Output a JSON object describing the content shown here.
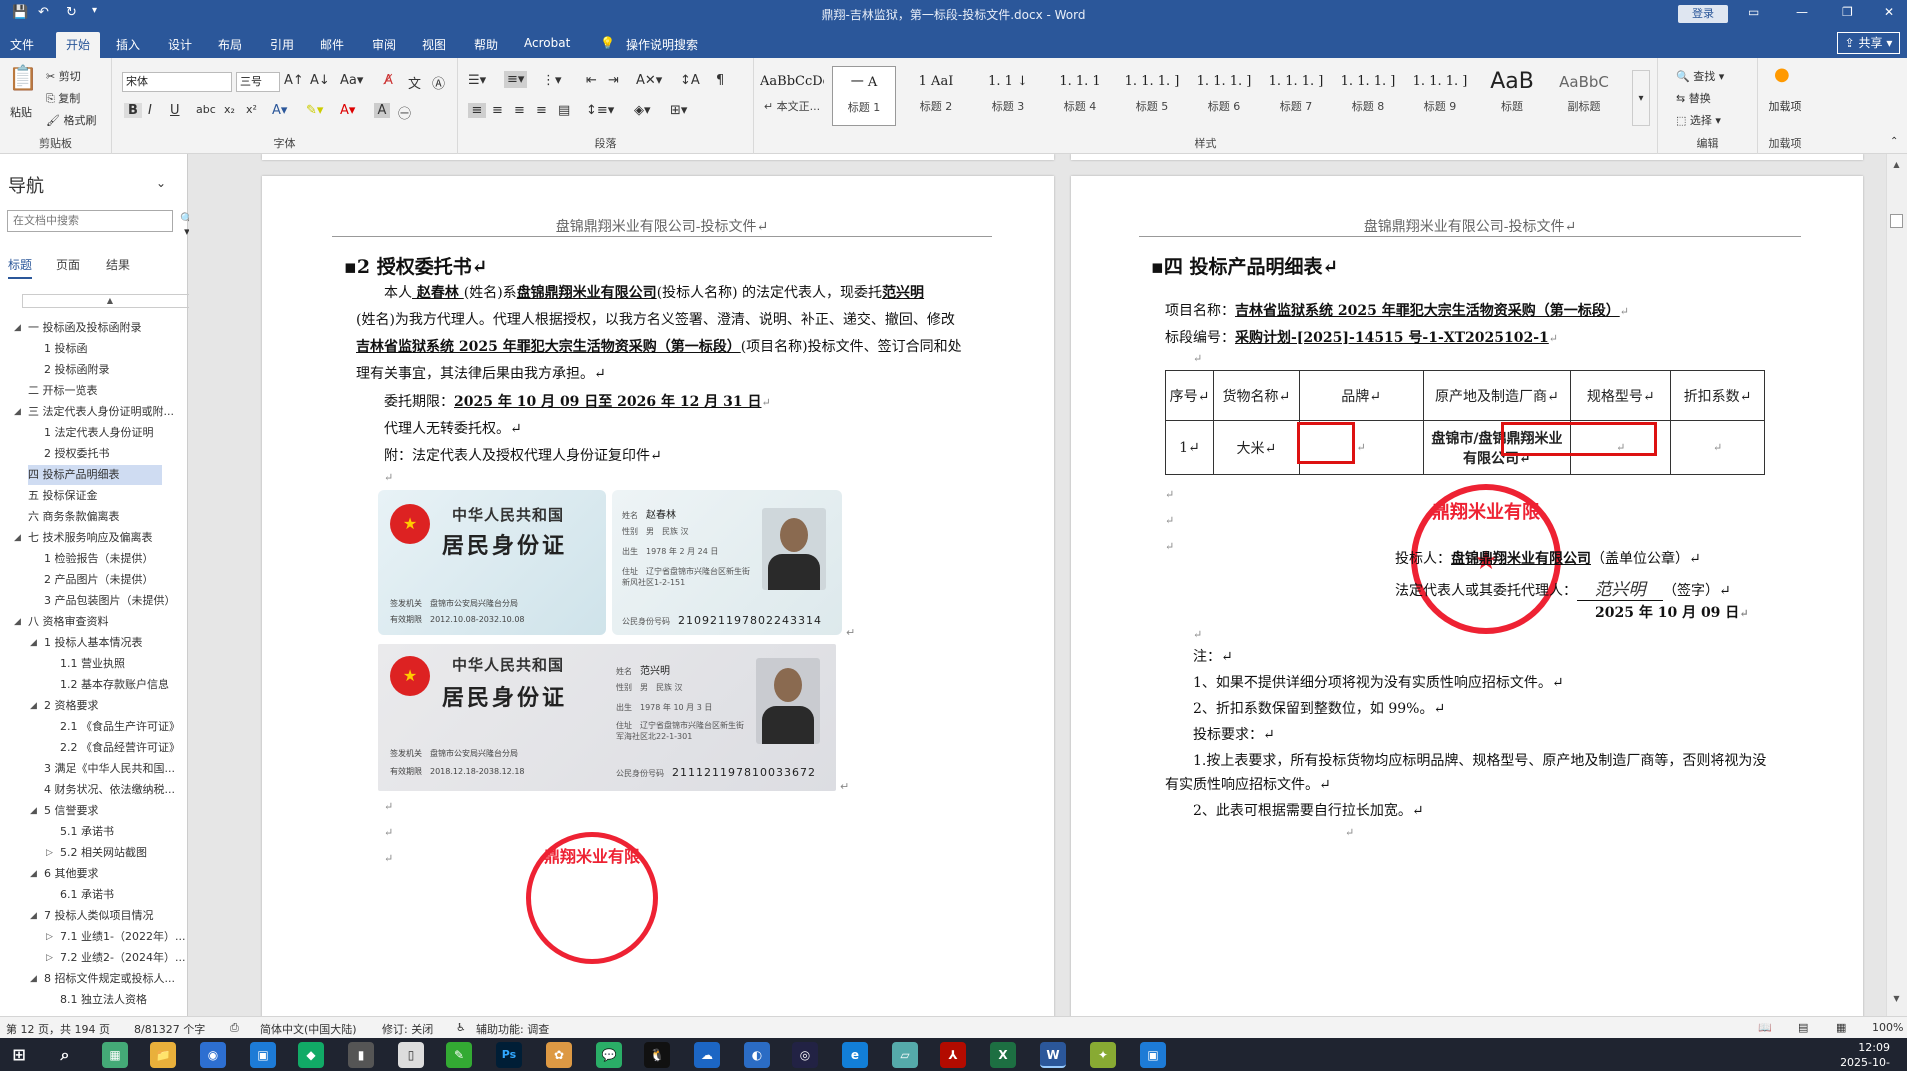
{
  "window": {
    "title": "鼎翔-吉林监狱，第一标段-投标文件.docx - Word",
    "login": "登录",
    "share": "共享"
  },
  "tabs": [
    "文件",
    "开始",
    "插入",
    "设计",
    "布局",
    "引用",
    "邮件",
    "审阅",
    "视图",
    "帮助",
    "Acrobat",
    "操作说明搜索"
  ],
  "ribbon": {
    "clipboard": {
      "paste": "粘贴",
      "cut": "剪切",
      "copy": "复制",
      "format_painter": "格式刷",
      "label": "剪贴板"
    },
    "font": {
      "name": "宋体",
      "size": "三号",
      "label": "字体"
    },
    "paragraph": {
      "label": "段落"
    },
    "styles": {
      "label": "样式",
      "items": [
        {
          "preview": "AaBbCcDdI",
          "name": "↵ 本文正..."
        },
        {
          "preview": "一 A",
          "name": "标题 1"
        },
        {
          "preview": "1 AaI",
          "name": "标题 2"
        },
        {
          "preview": "1. 1 ↓",
          "name": "标题 3"
        },
        {
          "preview": "1. 1. 1",
          "name": "标题 4"
        },
        {
          "preview": "1. 1. 1. ]",
          "name": "标题 5"
        },
        {
          "preview": "1. 1. 1. ]",
          "name": "标题 6"
        },
        {
          "preview": "1. 1. 1. ]",
          "name": "标题 7"
        },
        {
          "preview": "1. 1. 1. ]",
          "name": "标题 8"
        },
        {
          "preview": "1. 1. 1. ]",
          "name": "标题 9"
        },
        {
          "preview": "AaB",
          "name": "标题"
        },
        {
          "preview": "AaBbC",
          "name": "副标题"
        }
      ]
    },
    "editing": {
      "find": "查找",
      "replace": "替换",
      "select": "选择",
      "label": "编辑"
    },
    "addins": {
      "load": "加载项",
      "label": "加载项"
    }
  },
  "nav": {
    "title": "导航",
    "search_placeholder": "在文档中搜索",
    "tabs": [
      "标题",
      "页面",
      "结果"
    ],
    "items": [
      {
        "text": "一 投标函及投标函附录",
        "level": 0,
        "tw": "◢"
      },
      {
        "text": "1 投标函",
        "level": 1,
        "tw": ""
      },
      {
        "text": "2 投标函附录",
        "level": 1,
        "tw": ""
      },
      {
        "text": "二 开标一览表",
        "level": 0,
        "tw": ""
      },
      {
        "text": "三 法定代表人身份证明或附...",
        "level": 0,
        "tw": "◢"
      },
      {
        "text": "1 法定代表人身份证明",
        "level": 1,
        "tw": ""
      },
      {
        "text": "2 授权委托书",
        "level": 1,
        "tw": ""
      },
      {
        "text": "四 投标产品明细表",
        "level": 0,
        "tw": "",
        "selected": true
      },
      {
        "text": "五 投标保证金",
        "level": 0,
        "tw": ""
      },
      {
        "text": "六 商务条款偏离表",
        "level": 0,
        "tw": ""
      },
      {
        "text": "七 技术服务响应及偏离表",
        "level": 0,
        "tw": "◢"
      },
      {
        "text": "1 检验报告（未提供）",
        "level": 1,
        "tw": ""
      },
      {
        "text": "2 产品图片（未提供）",
        "level": 1,
        "tw": ""
      },
      {
        "text": "3 产品包装图片（未提供）",
        "level": 1,
        "tw": ""
      },
      {
        "text": "八 资格审查资料",
        "level": 0,
        "tw": "◢"
      },
      {
        "text": "1 投标人基本情况表",
        "level": 1,
        "tw": "◢"
      },
      {
        "text": "1.1 营业执照",
        "level": 2,
        "tw": ""
      },
      {
        "text": "1.2 基本存款账户信息",
        "level": 2,
        "tw": ""
      },
      {
        "text": "2 资格要求",
        "level": 1,
        "tw": "◢"
      },
      {
        "text": "2.1 《食品生产许可证》",
        "level": 2,
        "tw": ""
      },
      {
        "text": "2.2 《食品经营许可证》",
        "level": 2,
        "tw": ""
      },
      {
        "text": "3 满足《中华人民共和国...",
        "level": 1,
        "tw": ""
      },
      {
        "text": "4 财务状况、依法缴纳税...",
        "level": 1,
        "tw": ""
      },
      {
        "text": "5 信誉要求",
        "level": 1,
        "tw": "◢"
      },
      {
        "text": "5.1 承诺书",
        "level": 2,
        "tw": ""
      },
      {
        "text": "5.2 相关网站截图",
        "level": 2,
        "tw": "▷"
      },
      {
        "text": "6 其他要求",
        "level": 1,
        "tw": "◢"
      },
      {
        "text": "6.1 承诺书",
        "level": 2,
        "tw": ""
      },
      {
        "text": "7 投标人类似项目情况",
        "level": 1,
        "tw": "◢"
      },
      {
        "text": "7.1 业绩1-（2022年）...",
        "level": 2,
        "tw": "▷"
      },
      {
        "text": "7.2 业绩2-（2024年）...",
        "level": 2,
        "tw": "▷"
      },
      {
        "text": "8 招标文件规定或投标人...",
        "level": 1,
        "tw": "◢"
      },
      {
        "text": "8.1 独立法人资格",
        "level": 2,
        "tw": ""
      }
    ]
  },
  "page_left": {
    "header": "盘锦鼎翔米业有限公司-投标文件↵",
    "heading": "2 授权委托书↵",
    "p1a": "本人",
    "p1_name": "  赵春林  ",
    "p1b": "(姓名)系",
    "p1_company": "盘锦鼎翔米业有限公司",
    "p1c": "(投标人名称) 的法定代表人，现委托",
    "p1_agent": "范兴明  ",
    "p2": "(姓名)为我方代理人。代理人根据授权，以我方名义签署、澄清、说明、补正、递交、撤回、修改",
    "p3_project": "吉林省监狱系统 2025 年罪犯大宗生活物资采购（第一标段）",
    "p3b": "(项目名称)投标文件、签订合同和处",
    "p4": "理有关事宜，其法律后果由我方承担。↵",
    "p5a": "委托期限：",
    "p5_period": "2025 年 10 月 09 日至 2026 年 12 月 31 日",
    "p6": "代理人无转委托权。↵",
    "p7": "附：法定代表人及授权代理人身份证复印件↵",
    "id1": {
      "country": "中华人民共和国",
      "title": "居民身份证",
      "authority_label": "签发机关",
      "authority": "盘锦市公安局兴隆台分局",
      "valid_label": "有效期限",
      "valid": "2012.10.08-2032.10.08",
      "name_label": "姓名",
      "name": "赵春林",
      "sex_label": "性别",
      "sex": "男",
      "nation_label": "民族",
      "nation": "汉",
      "birth_label": "出生",
      "birth": "1978 年 2 月 24 日",
      "addr_label": "住址",
      "addr": "辽宁省盘锦市兴隆台区新生街新风社区1-2-151",
      "id_label": "公民身份号码",
      "id": "210921197802243314"
    },
    "id2": {
      "country": "中华人民共和国",
      "title": "居民身份证",
      "authority_label": "签发机关",
      "authority": "盘锦市公安局兴隆台分局",
      "valid_label": "有效期限",
      "valid": "2018.12.18-2038.12.18",
      "name_label": "姓名",
      "name": "范兴明",
      "sex_label": "性别",
      "sex": "男",
      "nation_label": "民族",
      "nation": "汉",
      "birth_label": "出生",
      "birth": "1978 年 10 月 3 日",
      "addr_label": "住址",
      "addr": "辽宁省盘锦市兴隆台区新生街军海社区北22-1-301",
      "id_label": "公民身份号码",
      "id": "211121197810033672"
    },
    "seal_text": "鼎翔米业有限"
  },
  "page_right": {
    "header": "盘锦鼎翔米业有限公司-投标文件↵",
    "heading": "四 投标产品明细表↵",
    "proj_label": "项目名称：",
    "proj": "吉林省监狱系统 2025 年罪犯大宗生活物资采购（第一标段）",
    "code_label": "标段编号：",
    "code": "采购计划-[2025]-14515 号-1-XT2025102-1",
    "table_headers": [
      "序号↵",
      "货物名称↵",
      "品牌↵",
      "原产地及制造厂商↵",
      "规格型号↵",
      "折扣系数↵"
    ],
    "table_row": [
      "1↵",
      "大米↵",
      "↵",
      "盘锦市/盘锦鼎翔米业有限公司↵",
      "↵",
      "↵"
    ],
    "bidder_label": "投标人：",
    "bidder": "盘锦鼎翔米业有限公司",
    "bidder_suffix": "（盖单位公章）↵",
    "rep_label": "法定代表人或其委托代理人：",
    "signature": "范兴明",
    "rep_suffix": "（签字）↵",
    "date": "2025 年 10 月 09 日",
    "note_title": "注：↵",
    "note1": "1、如果不提供详细分项将视为没有实质性响应招标文件。↵",
    "note2": "2、折扣系数保留到整数位，如 99%。↵",
    "req_title": "投标要求：↵",
    "req1a": "1.按上表要求，所有投标货物均应标明品牌、规格型号、原产地及制造厂商等，否则将视为没",
    "req1b": "有实质性响应招标文件。↵",
    "req2": "2、此表可根据需要自行拉长加宽。↵",
    "seal_text": "鼎翔米业有限"
  },
  "status": {
    "page": "第 12 页，共 194 页",
    "words": "8/81327 个字",
    "lang": "简体中文(中国大陆)",
    "track": "修订: 关闭",
    "access": "辅助功能: 调查",
    "zoom": "100%"
  },
  "taskbar": {
    "time": "12:09",
    "date": "2025-10-16"
  }
}
